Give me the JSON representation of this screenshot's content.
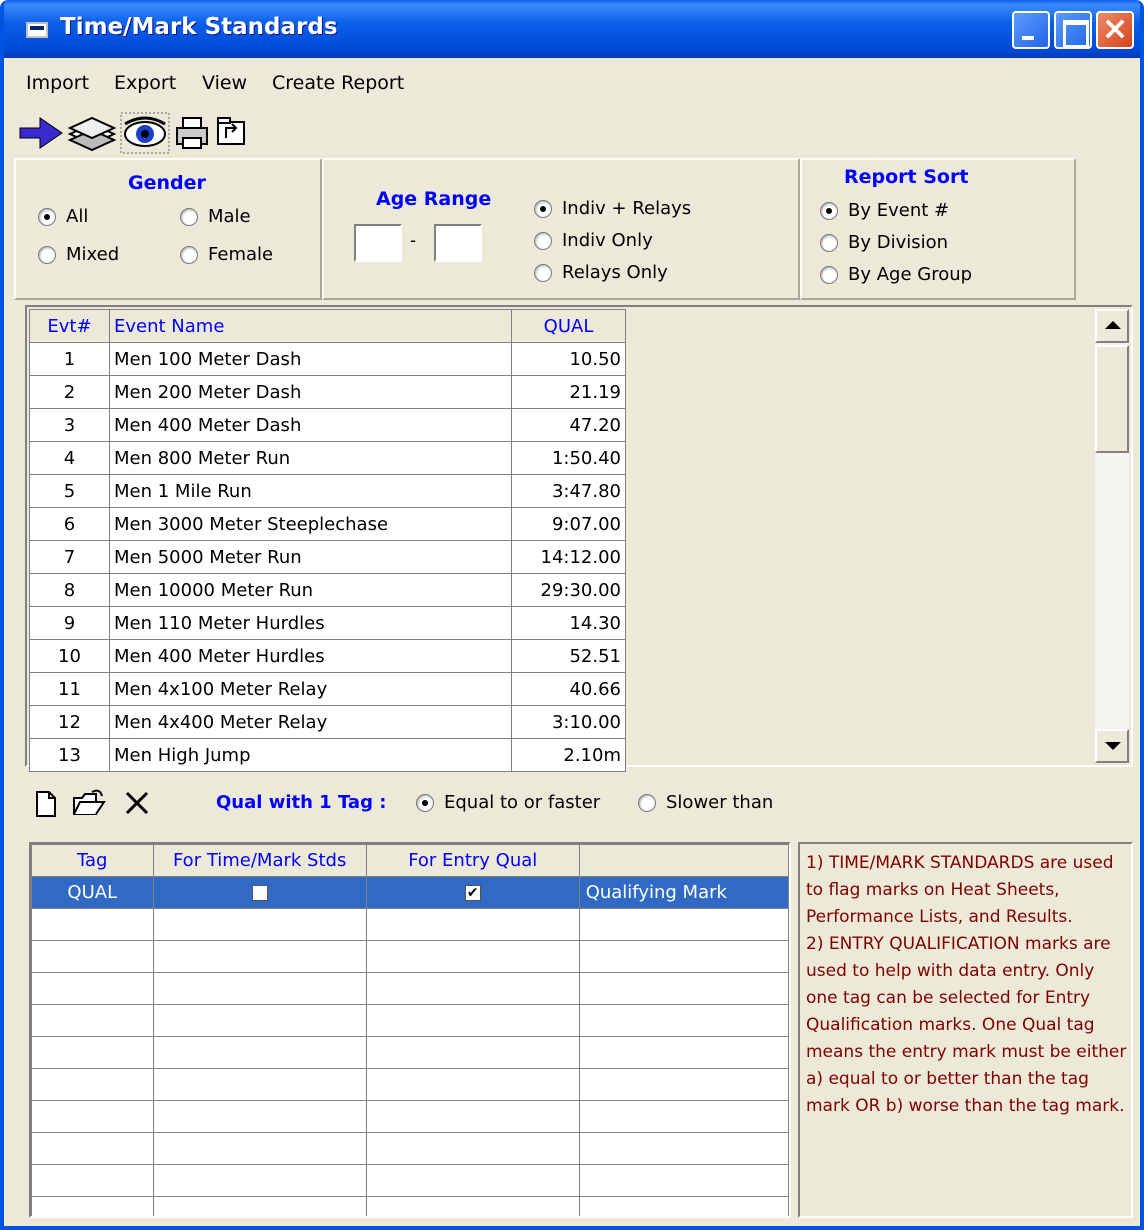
{
  "window": {
    "title": "Time/Mark Standards"
  },
  "menu": [
    "Import",
    "Export",
    "View",
    "Create Report"
  ],
  "toolbar": {
    "icons": [
      "arrow-right-icon",
      "layers-icon",
      "eye-icon",
      "printer-icon",
      "folder-up-icon"
    ]
  },
  "gender": {
    "title": "Gender",
    "options": [
      {
        "label": "All",
        "selected": true
      },
      {
        "label": "Male",
        "selected": false
      },
      {
        "label": "Mixed",
        "selected": false
      },
      {
        "label": "Female",
        "selected": false
      }
    ]
  },
  "age_range": {
    "title": "Age Range",
    "from": "",
    "to": "",
    "separator": "-"
  },
  "event_filter": {
    "options": [
      {
        "label": "Indiv + Relays",
        "selected": true
      },
      {
        "label": "Indiv Only",
        "selected": false
      },
      {
        "label": "Relays Only",
        "selected": false
      }
    ]
  },
  "report_sort": {
    "title": "Report Sort",
    "options": [
      {
        "label": "By Event #",
        "selected": true
      },
      {
        "label": "By Division",
        "selected": false
      },
      {
        "label": "By Age Group",
        "selected": false
      }
    ]
  },
  "events_table": {
    "headers": [
      "Evt#",
      "Event Name",
      "QUAL"
    ],
    "rows": [
      [
        "1",
        "Men 100 Meter Dash",
        "10.50"
      ],
      [
        "2",
        "Men 200 Meter Dash",
        "21.19"
      ],
      [
        "3",
        "Men 400 Meter Dash",
        "47.20"
      ],
      [
        "4",
        "Men 800 Meter Run",
        "1:50.40"
      ],
      [
        "5",
        "Men 1 Mile Run",
        "3:47.80"
      ],
      [
        "6",
        "Men 3000 Meter Steeplechase",
        "9:07.00"
      ],
      [
        "7",
        "Men 5000 Meter Run",
        "14:12.00"
      ],
      [
        "8",
        "Men 10000 Meter Run",
        "29:30.00"
      ],
      [
        "9",
        "Men 110 Meter Hurdles",
        "14.30"
      ],
      [
        "10",
        "Men 400 Meter Hurdles",
        "52.51"
      ],
      [
        "11",
        "Men 4x100 Meter Relay",
        "40.66"
      ],
      [
        "12",
        "Men 4x400 Meter Relay",
        "3:10.00"
      ],
      [
        "13",
        "Men High Jump",
        "2.10m"
      ]
    ]
  },
  "qual_tag": {
    "label": "Qual with 1 Tag :",
    "options": [
      {
        "label": "Equal to or faster",
        "selected": true
      },
      {
        "label": "Slower than",
        "selected": false
      }
    ]
  },
  "tags_table": {
    "headers": [
      "Tag",
      "For Time/Mark Stds",
      "For Entry Qual",
      ""
    ],
    "rows": [
      {
        "tag": "QUAL",
        "time_mark_std": false,
        "entry_qual": true,
        "description": "Qualifying Mark",
        "selected": true
      }
    ],
    "empty_rows": 11
  },
  "notes": {
    "lines": [
      "1)  TIME/MARK STANDARDS are used to flag marks on Heat Sheets, Performance Lists, and Results.",
      "2)  ENTRY QUALIFICATION marks are used to help with data entry. Only one tag can be selected for Entry Qualification marks. One Qual tag means the entry mark must be either a) equal to or better than the tag mark OR b) worse than the tag mark."
    ]
  }
}
